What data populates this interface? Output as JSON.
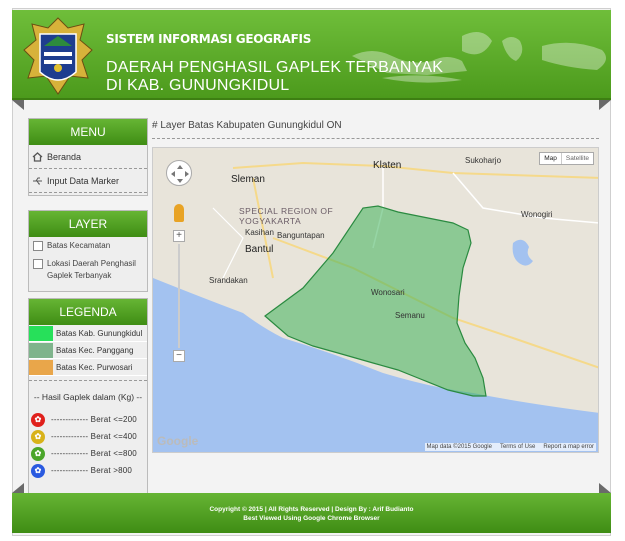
{
  "header": {
    "title_line1": "SISTEM INFORMASI GEOGRAFIS",
    "title_line2": "DAERAH PENGHASIL GAPLEK TERBANYAK",
    "title_line3": "DI KAB. GUNUNGKIDUL"
  },
  "menu": {
    "heading": "MENU",
    "items": [
      {
        "label": "Beranda",
        "icon": "home-icon"
      },
      {
        "label": "Input Data Marker",
        "icon": "usb-icon"
      }
    ]
  },
  "layer": {
    "heading": "LAYER",
    "items": [
      {
        "label": "Batas Kecamatan",
        "checked": false
      },
      {
        "label": "Lokasi Daerah Penghasil Gaplek Terbanyak",
        "checked": false
      }
    ]
  },
  "legenda": {
    "heading": "LEGENDA",
    "items": [
      {
        "label": "Batas Kab. Gunungkidul",
        "color": "#27e05a"
      },
      {
        "label": "Batas Kec. Panggang",
        "color": "#7fb48c"
      },
      {
        "label": "Batas Kec. Purwosari",
        "color": "#e9a64a"
      }
    ],
    "hasil_heading": "-- Hasil Gaplek dalam (Kg) --",
    "berat": [
      {
        "label": "------------- Berat <=200",
        "color": "#e0201c"
      },
      {
        "label": "------------- Berat <=400",
        "color": "#d8b21a"
      },
      {
        "label": "------------- Berat <=800",
        "color": "#4aa52a"
      },
      {
        "label": "------------- Berat >800",
        "color": "#2a5ae0"
      }
    ]
  },
  "content": {
    "layer_status": "# Layer Batas Kabupaten Gunungkidul ON"
  },
  "map": {
    "type_buttons": [
      "Map",
      "Satellite"
    ],
    "zoom_in": "+",
    "zoom_out": "−",
    "labels": {
      "klaten": "Klaten",
      "sleman": "Sleman",
      "sukoharjo": "Sukoharjo",
      "region": "SPECIAL REGION OF YOGYAKARTA",
      "kasihan": "Kasihan",
      "banguntapan": "Banguntapan",
      "wonogiri": "Wonogiri",
      "bantul": "Bantul",
      "srandakan": "Srandakan",
      "wonosari": "Wonosari",
      "semanu": "Semanu"
    },
    "google": "Google",
    "attribution": [
      "Map data ©2015 Google",
      "Terms of Use",
      "Report a map error"
    ],
    "polygon_color": "#3fb25b"
  },
  "footer": {
    "line1": "Copyright © 2015 | All Rights Reserved | Design By : Arif Budianto",
    "line2": "Best Viewed Using Google Chrome Browser"
  }
}
